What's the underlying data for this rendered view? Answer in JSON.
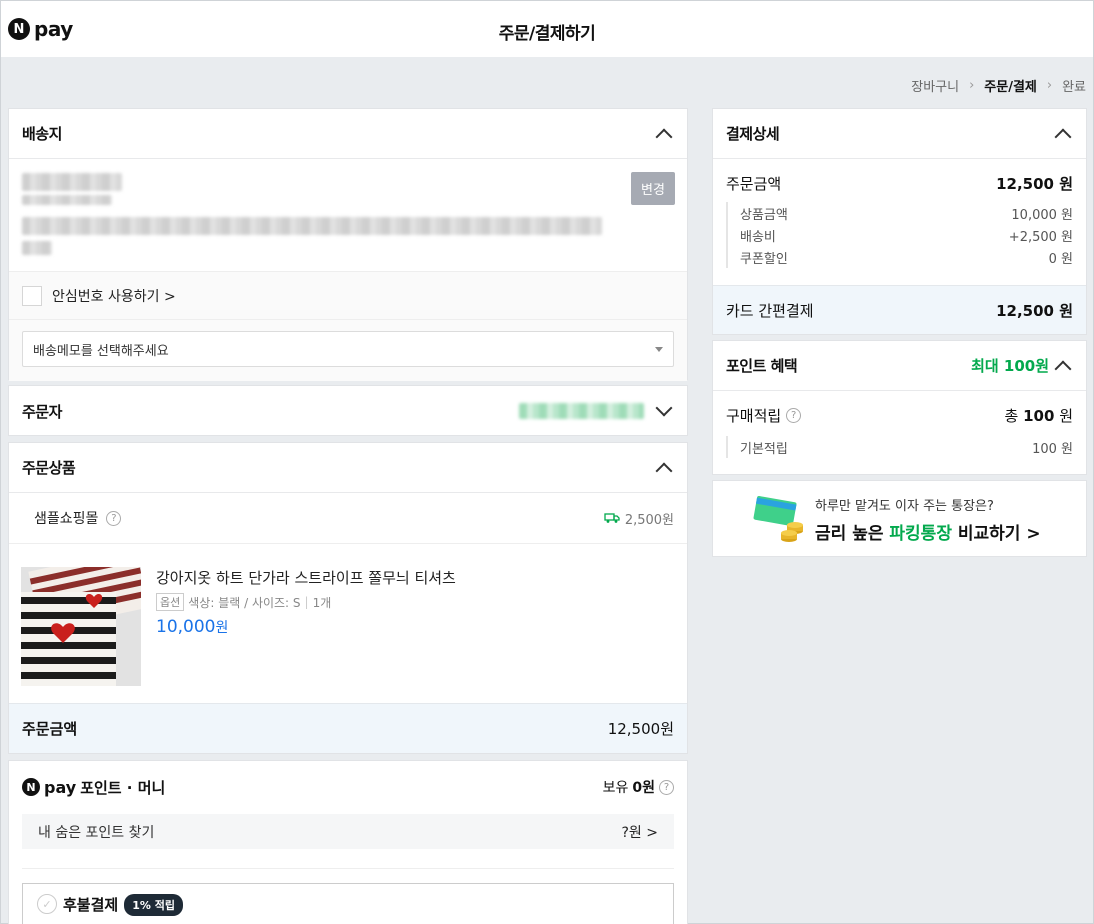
{
  "header": {
    "logo_text": "pay",
    "logo_badge": "N",
    "title": "주문/결제하기"
  },
  "breadcrumb": [
    "장바구니",
    "주문/결제",
    "완료"
  ],
  "shipping": {
    "title": "배송지",
    "change_label": "변경",
    "safe_number_label": "안심번호 사용하기 >",
    "memo_placeholder": "배송메모를 선택해주세요"
  },
  "orderer": {
    "title": "주문자"
  },
  "products": {
    "title": "주문상품",
    "store_name": "샘플쇼핑몰",
    "shipping_fee": "2,500원",
    "item": {
      "name": "강아지옷 하트 단가라 스트라이프 쫄무늬 티셔츠",
      "option_tag": "옵션",
      "option_text": "색상: 블랙 / 사이즈: S",
      "qty": "1개",
      "price": "10,000",
      "price_unit": "원"
    },
    "total_label": "주문금액",
    "total_value": "12,500원"
  },
  "npay_points": {
    "badge": "N",
    "pay_text": "pay",
    "title": "포인트 · 머니",
    "owned_label": "보유",
    "owned_value": "0원",
    "hidden_label": "내 숨은 포인트 찾기",
    "hidden_value": "?원 >",
    "later_pay_label": "후불결제",
    "later_pay_badge": "1% 적립"
  },
  "payment_detail": {
    "title": "결제상세",
    "order_amount_label": "주문금액",
    "order_amount_value": "12,500 원",
    "lines": [
      {
        "label": "상품금액",
        "value": "10,000 원"
      },
      {
        "label": "배송비",
        "value": "+2,500 원"
      },
      {
        "label": "쿠폰할인",
        "value": "0 원"
      }
    ],
    "card_label": "카드 간편결제",
    "card_value": "12,500 원"
  },
  "point_benefit": {
    "title": "포인트 혜택",
    "max_label": "최대 100원",
    "purchase_label": "구매적립",
    "purchase_value_prefix": "총",
    "purchase_value": "100",
    "purchase_value_unit": "원",
    "base_label": "기본적립",
    "base_value": "100 원"
  },
  "banner": {
    "line1": "하루만 맡겨도 이자 주는 통장은?",
    "line2_a": "금리 높은",
    "line2_b": "파킹통장",
    "line2_c": "비교하기 >"
  }
}
